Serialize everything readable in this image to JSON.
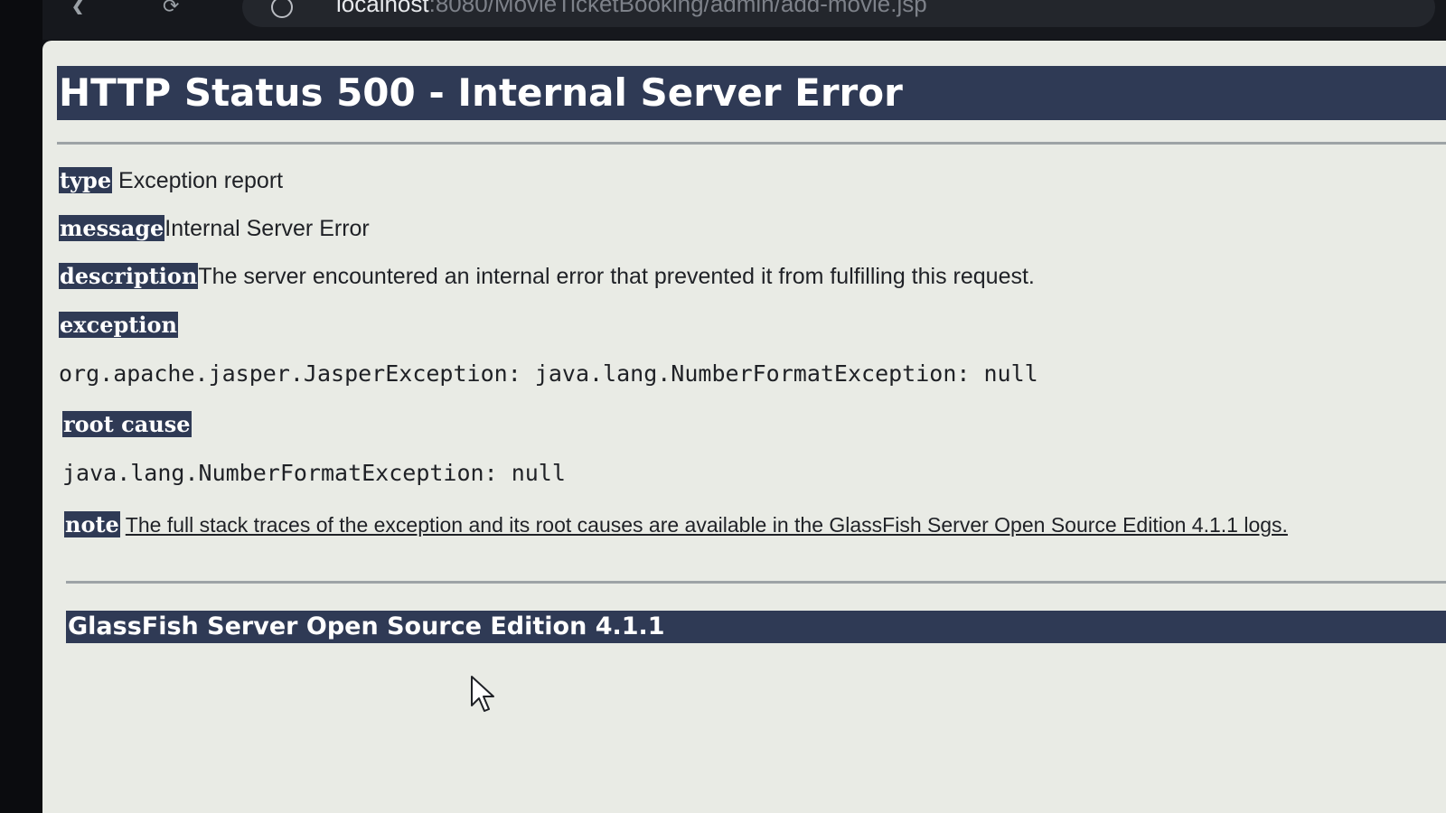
{
  "browser": {
    "back_icon": "back-arrow-icon",
    "reload_icon": "reload-icon",
    "url_host": "localhost",
    "url_rest": ":8080/MovieTicketBooking/admin/add-movie.jsp"
  },
  "page": {
    "title": "HTTP Status 500 - Internal Server Error",
    "rows": {
      "type_label": "type",
      "type_value": "Exception report",
      "message_label": "message",
      "message_value": "Internal Server Error",
      "description_label": "description",
      "description_value": "The server encountered an internal error that prevented it from fulfilling this request.",
      "exception_label": "exception",
      "exception_value": "org.apache.jasper.JasperException: java.lang.NumberFormatException: null",
      "root_cause_label": "root cause",
      "root_cause_value": "java.lang.NumberFormatException: null",
      "note_label": "note",
      "note_value": "The full stack traces of the exception and its root causes are available in the GlassFish Server Open Source Edition 4.1.1 logs."
    },
    "footer": "GlassFish Server Open Source Edition 4.1.1"
  },
  "colors": {
    "header_bg": "#2f3a55",
    "page_bg": "#e9ebe5",
    "text": "#1f2126"
  }
}
